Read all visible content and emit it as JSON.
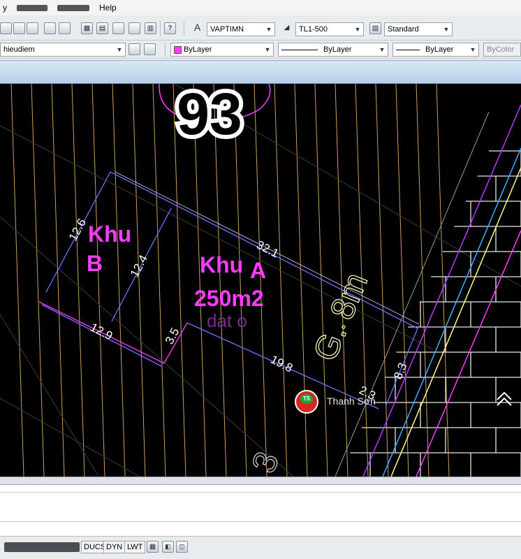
{
  "menu": {
    "items": [
      "y",
      "Help"
    ]
  },
  "toolbar": {
    "text_style": "VAPTIMN",
    "dim_style": "TL1-500",
    "table_style": "Standard",
    "layer_name": "hieudiem",
    "color": "ByLayer",
    "linetype": "ByLayer",
    "lineweight": "ByLayer",
    "plot_style": "ByColor"
  },
  "drawing": {
    "plot_number": "93",
    "zone_b": [
      "Khu",
      "B"
    ],
    "zone_a": [
      "Khu",
      "A"
    ],
    "area": "250m2",
    "land_code": "dat o",
    "road_label": "G. 8m",
    "partial_label": "3",
    "dimensions": {
      "b_left": "12.6",
      "b_right": "12.4",
      "b_bottom": "12.9",
      "top": "32.1",
      "gap": "3.5",
      "a_bottom": "19.8",
      "right": "8.3",
      "corner": "2.3"
    }
  },
  "watermark": {
    "badge": "TS",
    "text": "Thanh Sơn"
  },
  "status_bar": {
    "buttons": [
      "DUCS",
      "DYN",
      "LWT"
    ]
  },
  "colors": {
    "magenta": "#ff3cff",
    "dimension": "#7070ff",
    "background": "#000000",
    "grid_line": "#c8a060",
    "brick": "#f0f0f0"
  }
}
